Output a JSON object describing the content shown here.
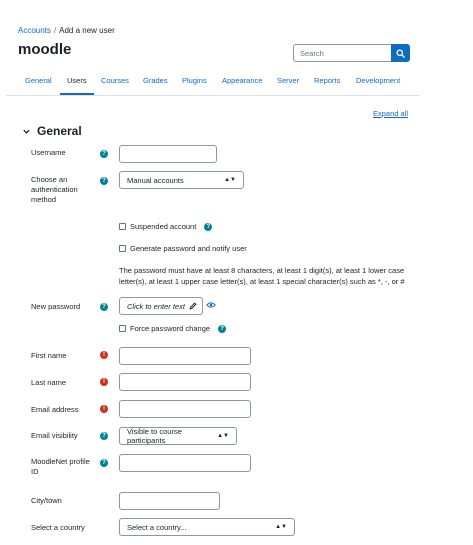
{
  "breadcrumb": {
    "items": [
      "Accounts",
      "Add a new user"
    ],
    "separator": "/"
  },
  "page": {
    "title": "moodle"
  },
  "search": {
    "placeholder": "Search"
  },
  "tabs": [
    {
      "label": "General"
    },
    {
      "label": "Users"
    },
    {
      "label": "Courses"
    },
    {
      "label": "Grades"
    },
    {
      "label": "Plugins"
    },
    {
      "label": "Appearance"
    },
    {
      "label": "Server"
    },
    {
      "label": "Reports"
    },
    {
      "label": "Development"
    }
  ],
  "expand_all": "Expand all",
  "section": {
    "title": "General"
  },
  "form": {
    "username": {
      "label": "Username",
      "value": ""
    },
    "auth": {
      "label": "Choose an authentication method",
      "selected": "Manual accounts"
    },
    "suspended": {
      "label": "Suspended account",
      "checked": false
    },
    "generate_password": {
      "label": "Generate password and notify user",
      "checked": false
    },
    "password_note": "The password must have at least 8 characters, at least 1 digit(s), at least 1 lower case letter(s), at least 1 upper case letter(s), at least 1 special character(s) such as *, -, or #",
    "new_password": {
      "label": "New password",
      "placeholder": "Click to enter text"
    },
    "force_change": {
      "label": "Force password change",
      "checked": false
    },
    "first_name": {
      "label": "First name",
      "value": ""
    },
    "last_name": {
      "label": "Last name",
      "value": ""
    },
    "email": {
      "label": "Email address",
      "value": ""
    },
    "email_visibility": {
      "label": "Email visibility",
      "selected": "Visible to course participants"
    },
    "moodlenet": {
      "label": "MoodleNet profile ID",
      "value": ""
    },
    "city": {
      "label": "City/town",
      "value": ""
    },
    "country": {
      "label": "Select a country",
      "selected": "Select a country..."
    }
  },
  "icons": {
    "help": "question-circle-icon",
    "required": "exclamation-circle-icon",
    "edit": "pencil-icon",
    "reveal": "eye-icon",
    "search": "search-icon",
    "collapse": "chevron-down-icon"
  },
  "colors": {
    "brand": "#0f6cbf",
    "help": "#008196",
    "required": "#ca3120",
    "text": "#1d2125"
  }
}
